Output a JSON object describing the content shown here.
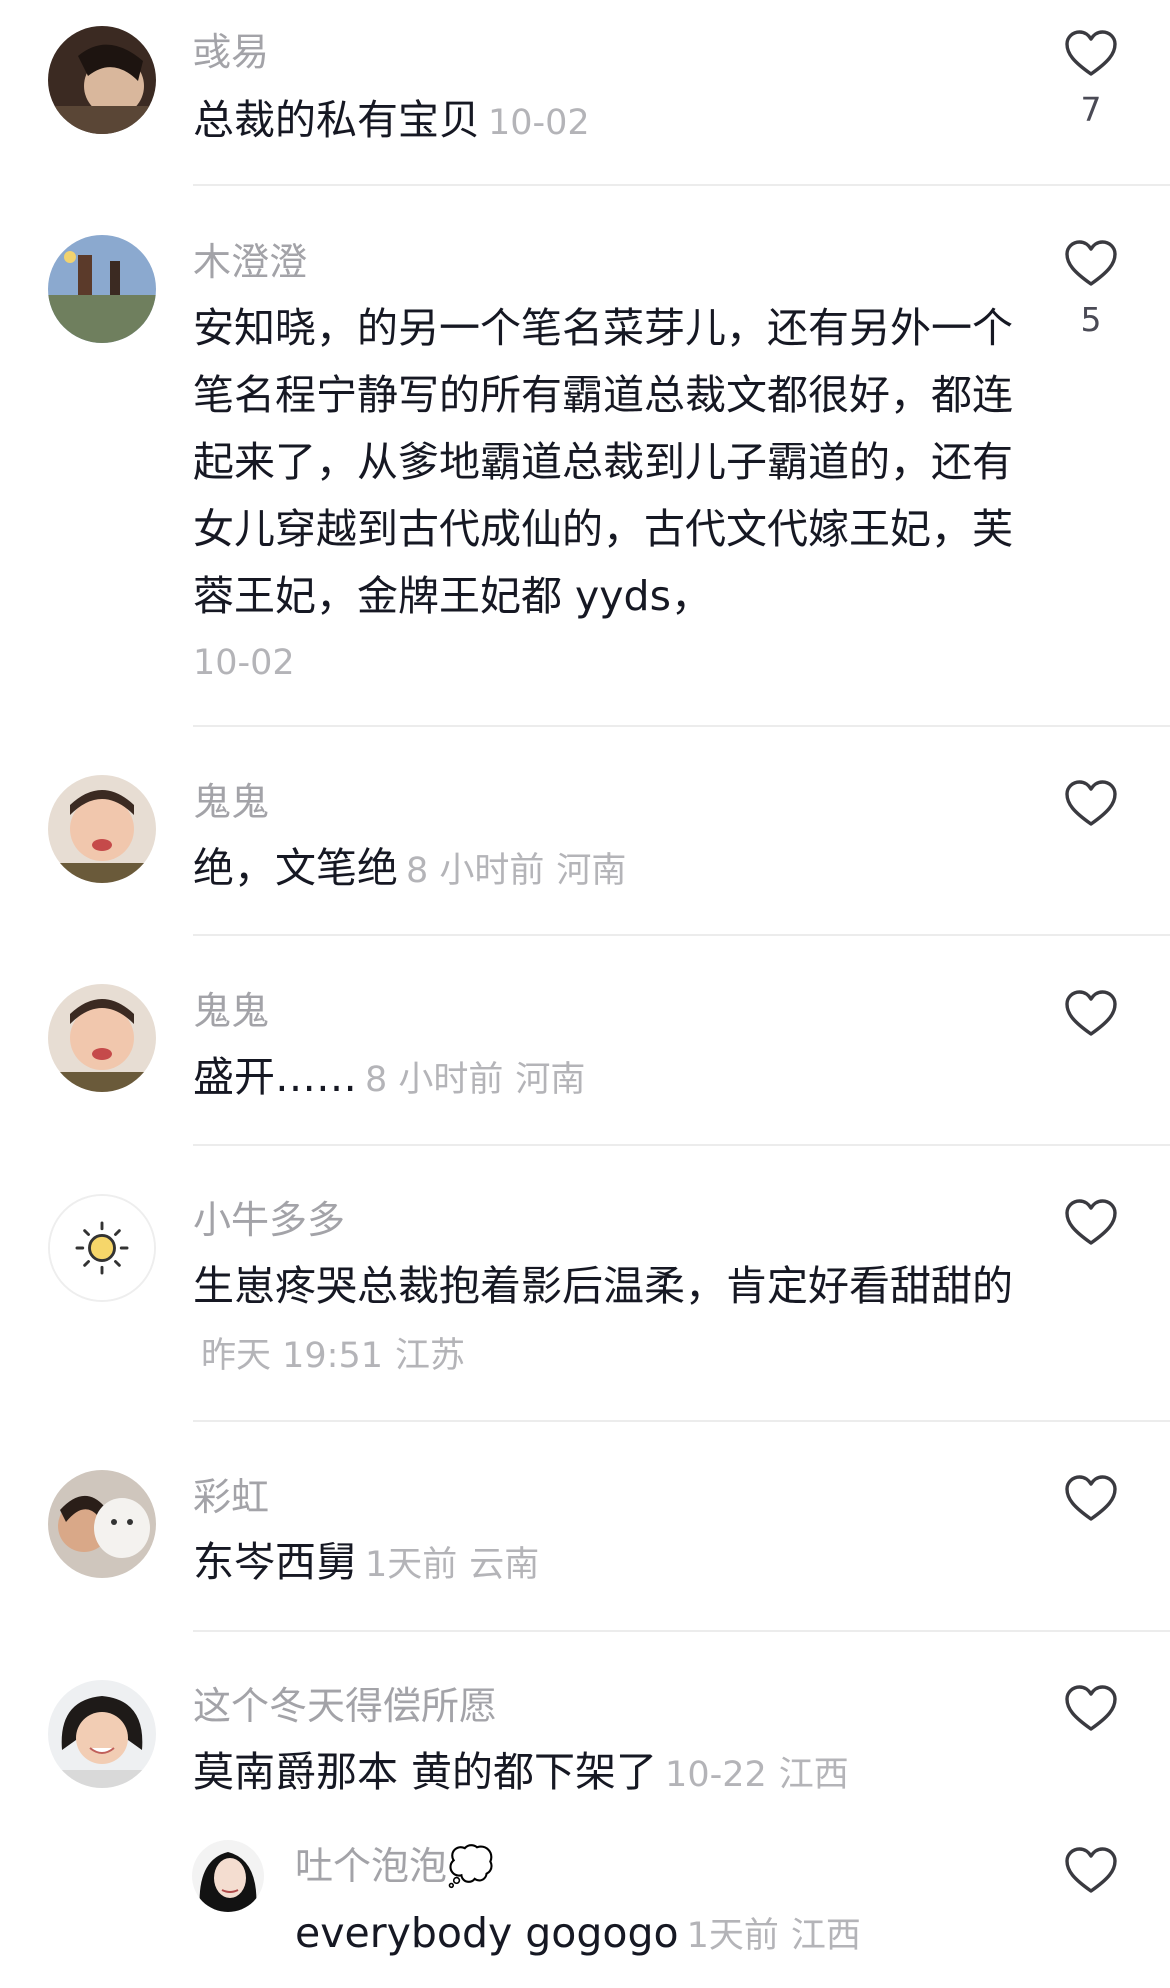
{
  "comments": [
    {
      "username": "彧易",
      "text": "总裁的私有宝贝",
      "time": "10-02",
      "location": "",
      "likes": "7"
    },
    {
      "username": "木澄澄",
      "text": "安知晓，的另一个笔名菜芽儿，还有另外一个笔名程宁静写的所有霸道总裁文都很好，都连起来了，从爹地霸道总裁到儿子霸道的，还有女儿穿越到古代成仙的，古代文代嫁王妃，芙蓉王妃，金牌王妃都 yyds，",
      "time": "10-02",
      "location": "",
      "likes": "5"
    },
    {
      "username": "鬼鬼",
      "text": "绝，文笔绝",
      "time": "8 小时前",
      "location": "河南",
      "likes": ""
    },
    {
      "username": "鬼鬼",
      "text": "盛开……",
      "time": "8 小时前",
      "location": "河南",
      "likes": ""
    },
    {
      "username": "小牛多多",
      "text": "生崽疼哭总裁抱着影后温柔，肯定好看甜甜的",
      "time": "昨天 19:51",
      "location": "江苏",
      "likes": ""
    },
    {
      "username": "彩虹",
      "text": "东岑西舅",
      "time": "1天前",
      "location": "云南",
      "likes": ""
    },
    {
      "username": "这个冬天得偿所愿",
      "text": "莫南爵那本 黄的都下架了",
      "time": "10-22",
      "location": "江西",
      "likes": ""
    }
  ],
  "reply": {
    "username": "吐个泡泡💭",
    "text": "everybody gogogo",
    "time": "1天前",
    "location": "江西",
    "likes": ""
  },
  "colors": {
    "text": "#161823",
    "muted": "#a3a3a8",
    "divider": "#ececec",
    "icon": "#3a3a40"
  }
}
